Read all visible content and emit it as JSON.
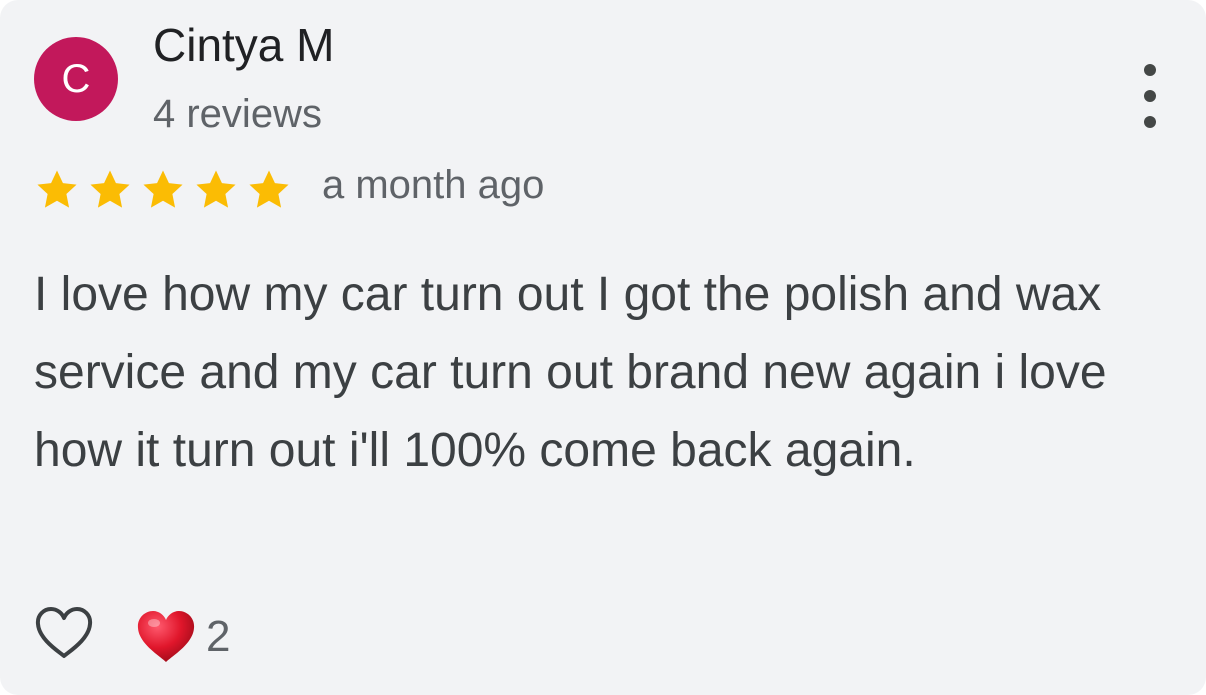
{
  "reviewer": {
    "avatar_initial": "C",
    "avatar_color": "#c2185b",
    "name": "Cintya M",
    "review_count_text": "4 reviews"
  },
  "menu": {
    "icon": "more-vert-icon"
  },
  "rating": {
    "stars": 5,
    "max_stars": 5,
    "star_color": "#fbbc04",
    "time_ago": "a month ago"
  },
  "review": {
    "text": "I love how my car turn out I got the polish and wax service and my car turn out brand new again i love how it turn out i'll 100% come back again."
  },
  "reactions": {
    "like_icon": "heart-outline-icon",
    "reaction_icon": "red-heart-icon",
    "reaction_color": "#e0162b",
    "count": "2"
  }
}
